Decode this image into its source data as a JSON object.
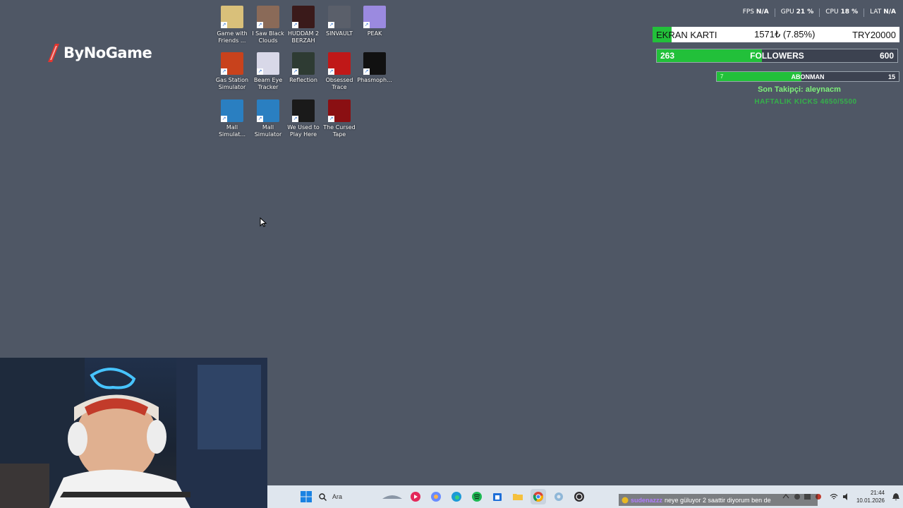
{
  "desktop_icons": [
    {
      "label": "Game with Friends ...",
      "icon": "game-with-friends-icon",
      "color": "#d9c07a"
    },
    {
      "label": "I Saw Black Clouds",
      "icon": "i-saw-black-clouds-icon",
      "color": "#8a6a58"
    },
    {
      "label": "HUDDAM 2 BERZAH",
      "icon": "huddam-icon",
      "color": "#3a1a1a"
    },
    {
      "label": "SINVAULT",
      "icon": "sinvault-icon",
      "color": "#5a5f6a"
    },
    {
      "label": "PEAK",
      "icon": "peak-icon",
      "color": "#9b8ae0"
    },
    {
      "label": "Gas Station Simulator",
      "icon": "gas-station-icon",
      "color": "#c8421c"
    },
    {
      "label": "Beam Eye Tracker",
      "icon": "beam-eye-icon",
      "color": "#d8d8e8"
    },
    {
      "label": "Reflection",
      "icon": "reflection-icon",
      "color": "#2e3b33"
    },
    {
      "label": "Obsessed Trace",
      "icon": "obsessed-trace-icon",
      "color": "#c01818"
    },
    {
      "label": "Phasmoph...",
      "icon": "phasmophobia-icon",
      "color": "#111111"
    },
    {
      "label": "Mall Simulat...",
      "icon": "mall-simulator-icon",
      "color": "#2a7fc1"
    },
    {
      "label": "Mall Simulator",
      "icon": "mall-simulator-icon",
      "color": "#2a7fc1"
    },
    {
      "label": "We Used to Play Here",
      "icon": "we-used-to-play-here-icon",
      "color": "#1a1a1a"
    },
    {
      "label": "The Cursed Tape",
      "icon": "cursed-tape-icon",
      "color": "#8a0f12"
    }
  ],
  "logo": {
    "text": "ByNoGame",
    "accent": "#e3362f"
  },
  "stats": {
    "fps_label": "FPS",
    "fps_value": "N/A",
    "gpu_label": "GPU",
    "gpu_value": "21 %",
    "cpu_label": "CPU",
    "cpu_value": "18 %",
    "lat_label": "LAT",
    "lat_value": "N/A"
  },
  "ekran": {
    "label": "EKRAN KARTI",
    "amount": "1571₺ (7.85%)",
    "goal": "TRY20000",
    "progress": 0.0785
  },
  "followers": {
    "current": "263",
    "label": "FOLLOWERS",
    "goal": "600",
    "progress": 0.438
  },
  "abonman": {
    "current": "7",
    "label": "ABONMAN",
    "goal": "15",
    "progress": 0.467
  },
  "son_takipci": "Son Takipçi: aleynacm",
  "haftalik_kicks": "HAFTALIK KICKS 4650/5500",
  "taskbar": {
    "search_placeholder": "Ara",
    "clock_time": "21:44",
    "clock_date": "10.01.2026"
  },
  "chat": {
    "user": "sudenazzz",
    "message": "neye güluyor 2 saattir diyorum ben de"
  },
  "colors": {
    "desktop": "#4f5765",
    "green": "#22c03a",
    "taskbar": "#dfe6ee"
  }
}
